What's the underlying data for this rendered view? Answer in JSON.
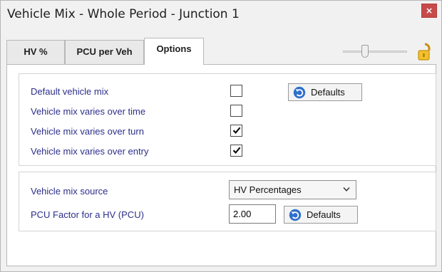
{
  "window": {
    "title": "Vehicle Mix - Whole Period - Junction 1",
    "close_glyph": "×"
  },
  "tabs": [
    {
      "label": "HV %",
      "active": false
    },
    {
      "label": "PCU per Veh",
      "active": false
    },
    {
      "label": "Options",
      "active": true
    }
  ],
  "toolbar": {
    "slider_icon": "slider",
    "lock_icon": "unlocked-padlock-icon"
  },
  "options": {
    "default_vehicle_mix": {
      "label": "Default vehicle mix",
      "checked": false
    },
    "varies_over_time": {
      "label": "Vehicle mix varies over time",
      "checked": false
    },
    "varies_over_turn": {
      "label": "Vehicle mix varies over turn",
      "checked": true
    },
    "varies_over_entry": {
      "label": "Vehicle mix varies over entry",
      "checked": true
    },
    "defaults_button_label": "Defaults"
  },
  "source": {
    "label": "Vehicle mix source",
    "selected": "HV Percentages",
    "pcu_factor_label": "PCU Factor for a HV (PCU)",
    "pcu_factor_value": "2.00",
    "defaults_button_label": "Defaults"
  },
  "colors": {
    "label_text": "#2c2f8a",
    "close_button": "#c74a4a",
    "lock_icon": "#e8b31e"
  }
}
